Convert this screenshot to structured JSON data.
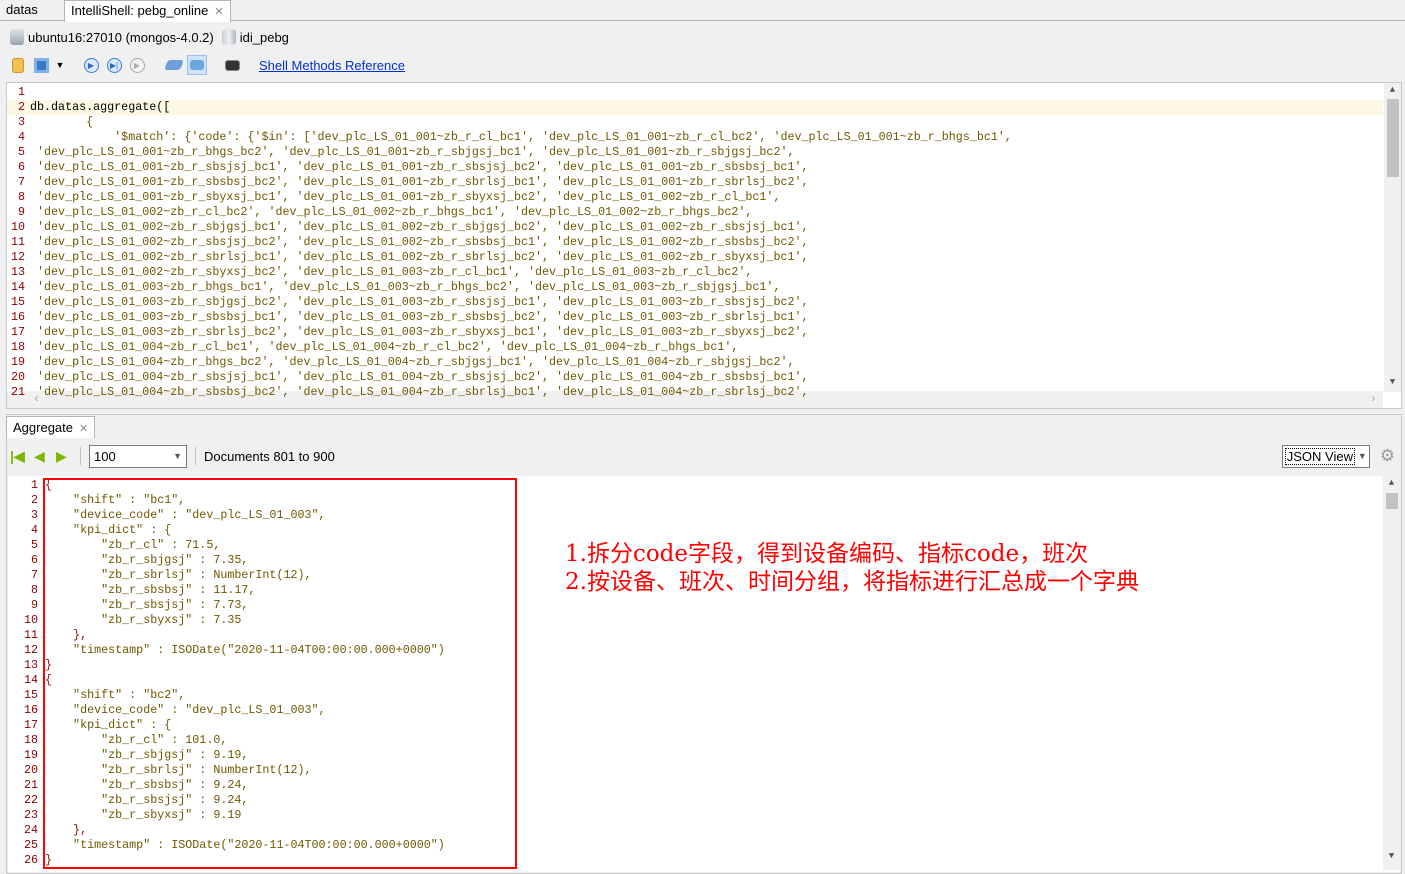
{
  "tabs": [
    {
      "label": "datas",
      "active": false
    },
    {
      "label": "IntelliShell: pebg_online",
      "active": true
    }
  ],
  "connection": {
    "server": "ubuntu16:27010 (mongos-4.0.2)",
    "database": "idi_pebg"
  },
  "toolbar": {
    "link": "Shell Methods Reference",
    "icons": [
      "open-file-icon",
      "save-icon",
      "dropdown-arrow-icon",
      "run-icon",
      "run-line-icon",
      "stop-icon",
      "clear-icon",
      "multi-result-icon",
      "console-icon"
    ]
  },
  "editor": {
    "current_line": 2,
    "lines": [
      "",
      "db.datas.aggregate([",
      "        {",
      "            '$match': {'code': {'$in': ['dev_plc_LS_01_001~zb_r_cl_bc1', 'dev_plc_LS_01_001~zb_r_cl_bc2', 'dev_plc_LS_01_001~zb_r_bhgs_bc1',",
      " 'dev_plc_LS_01_001~zb_r_bhgs_bc2', 'dev_plc_LS_01_001~zb_r_sbjgsj_bc1', 'dev_plc_LS_01_001~zb_r_sbjgsj_bc2',",
      " 'dev_plc_LS_01_001~zb_r_sbsjsj_bc1', 'dev_plc_LS_01_001~zb_r_sbsjsj_bc2', 'dev_plc_LS_01_001~zb_r_sbsbsj_bc1',",
      " 'dev_plc_LS_01_001~zb_r_sbsbsj_bc2', 'dev_plc_LS_01_001~zb_r_sbrlsj_bc1', 'dev_plc_LS_01_001~zb_r_sbrlsj_bc2',",
      " 'dev_plc_LS_01_001~zb_r_sbyxsj_bc1', 'dev_plc_LS_01_001~zb_r_sbyxsj_bc2', 'dev_plc_LS_01_002~zb_r_cl_bc1',",
      " 'dev_plc_LS_01_002~zb_r_cl_bc2', 'dev_plc_LS_01_002~zb_r_bhgs_bc1', 'dev_plc_LS_01_002~zb_r_bhgs_bc2',",
      " 'dev_plc_LS_01_002~zb_r_sbjgsj_bc1', 'dev_plc_LS_01_002~zb_r_sbjgsj_bc2', 'dev_plc_LS_01_002~zb_r_sbsjsj_bc1',",
      " 'dev_plc_LS_01_002~zb_r_sbsjsj_bc2', 'dev_plc_LS_01_002~zb_r_sbsbsj_bc1', 'dev_plc_LS_01_002~zb_r_sbsbsj_bc2',",
      " 'dev_plc_LS_01_002~zb_r_sbrlsj_bc1', 'dev_plc_LS_01_002~zb_r_sbrlsj_bc2', 'dev_plc_LS_01_002~zb_r_sbyxsj_bc1',",
      " 'dev_plc_LS_01_002~zb_r_sbyxsj_bc2', 'dev_plc_LS_01_003~zb_r_cl_bc1', 'dev_plc_LS_01_003~zb_r_cl_bc2',",
      " 'dev_plc_LS_01_003~zb_r_bhgs_bc1', 'dev_plc_LS_01_003~zb_r_bhgs_bc2', 'dev_plc_LS_01_003~zb_r_sbjgsj_bc1',",
      " 'dev_plc_LS_01_003~zb_r_sbjgsj_bc2', 'dev_plc_LS_01_003~zb_r_sbsjsj_bc1', 'dev_plc_LS_01_003~zb_r_sbsjsj_bc2',",
      " 'dev_plc_LS_01_003~zb_r_sbsbsj_bc1', 'dev_plc_LS_01_003~zb_r_sbsbsj_bc2', 'dev_plc_LS_01_003~zb_r_sbrlsj_bc1',",
      " 'dev_plc_LS_01_003~zb_r_sbrlsj_bc2', 'dev_plc_LS_01_003~zb_r_sbyxsj_bc1', 'dev_plc_LS_01_003~zb_r_sbyxsj_bc2',",
      " 'dev_plc_LS_01_004~zb_r_cl_bc1', 'dev_plc_LS_01_004~zb_r_cl_bc2', 'dev_plc_LS_01_004~zb_r_bhgs_bc1',",
      " 'dev_plc_LS_01_004~zb_r_bhgs_bc2', 'dev_plc_LS_01_004~zb_r_sbjgsj_bc1', 'dev_plc_LS_01_004~zb_r_sbjgsj_bc2',",
      " 'dev_plc_LS_01_004~zb_r_sbsjsj_bc1', 'dev_plc_LS_01_004~zb_r_sbsjsj_bc2', 'dev_plc_LS_01_004~zb_r_sbsbsj_bc1',",
      " 'dev_plc_LS_01_004~zb_r_sbsbsj_bc2', 'dev_plc_LS_01_004~zb_r_sbrlsj_bc1', 'dev_plc_LS_01_004~zb_r_sbrlsj_bc2',"
    ]
  },
  "results_panel": {
    "tab_label": "Aggregate",
    "page_size": "100",
    "documents_label": "Documents 801 to 900",
    "view_mode": "JSON View",
    "lines": [
      "{",
      "    \"shift\" : \"bc1\",",
      "    \"device_code\" : \"dev_plc_LS_01_003\",",
      "    \"kpi_dict\" : {",
      "        \"zb_r_cl\" : 71.5,",
      "        \"zb_r_sbjgsj\" : 7.35,",
      "        \"zb_r_sbrlsj\" : NumberInt(12),",
      "        \"zb_r_sbsbsj\" : 11.17,",
      "        \"zb_r_sbsjsj\" : 7.73,",
      "        \"zb_r_sbyxsj\" : 7.35",
      "    },",
      "    \"timestamp\" : ISODate(\"2020-11-04T00:00:00.000+0000\")",
      "}",
      "{",
      "    \"shift\" : \"bc2\",",
      "    \"device_code\" : \"dev_plc_LS_01_003\",",
      "    \"kpi_dict\" : {",
      "        \"zb_r_cl\" : 101.0,",
      "        \"zb_r_sbjgsj\" : 9.19,",
      "        \"zb_r_sbrlsj\" : NumberInt(12),",
      "        \"zb_r_sbsbsj\" : 9.24,",
      "        \"zb_r_sbsjsj\" : 9.24,",
      "        \"zb_r_sbyxsj\" : 9.19",
      "    },",
      "    \"timestamp\" : ISODate(\"2020-11-04T00:00:00.000+0000\")",
      "}"
    ]
  },
  "annotation": {
    "color": "#ff0000",
    "lines": [
      "1.拆分code字段，得到设备编码、指标code，班次",
      "2.按设备、班次、时间分组，将指标进行汇总成一个字典"
    ]
  }
}
